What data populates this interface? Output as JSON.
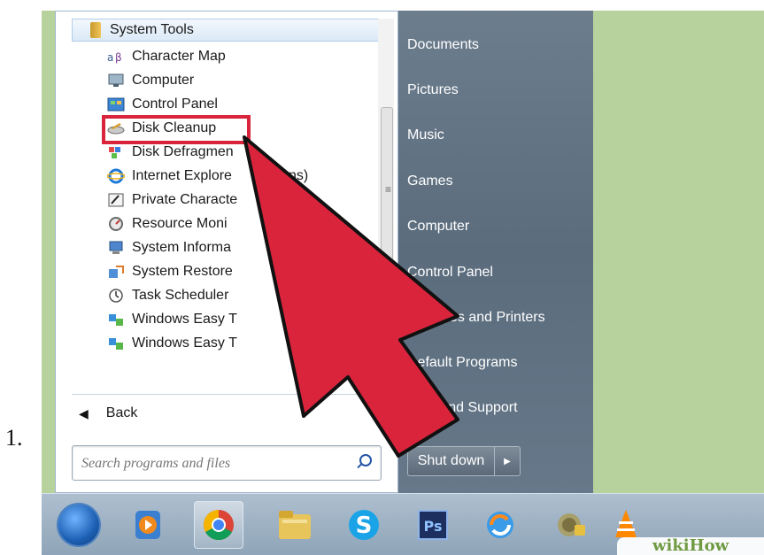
{
  "step": {
    "number": "1."
  },
  "program_list": {
    "folder": "System Tools",
    "items": [
      "Character Map",
      "Computer",
      "Control Panel",
      "Disk Cleanup",
      "Disk Defragmen",
      "Internet Explore",
      "Private Characte",
      "Resource Moni",
      "System Informa",
      "System Restore",
      "Task Scheduler",
      "Windows Easy T",
      "Windows Easy T"
    ],
    "ie_fragment": "dd-ons)",
    "highlighted": "Disk Cleanup"
  },
  "back": {
    "label": "Back"
  },
  "search": {
    "placeholder": "Search programs and files"
  },
  "right_pane": {
    "items": [
      "Documents",
      "Pictures",
      "Music",
      "Games",
      "Computer",
      "Control Panel",
      "es and Printers",
      "Default Programs",
      "Help and Support"
    ],
    "shutdown_label": "Shut down"
  },
  "taskbar": {
    "icons": [
      "start-orb-icon",
      "media-player-icon",
      "chrome-icon",
      "file-explorer-icon",
      "skype-icon",
      "photoshop-icon",
      "sync-icon",
      "security-icon",
      "vlc-icon"
    ],
    "active": "chrome-icon"
  },
  "watermark": {
    "text": "wikiHow"
  },
  "colors": {
    "background": "#b7d29c",
    "highlight": "#d9243c",
    "right_pane": "#5f7080"
  }
}
